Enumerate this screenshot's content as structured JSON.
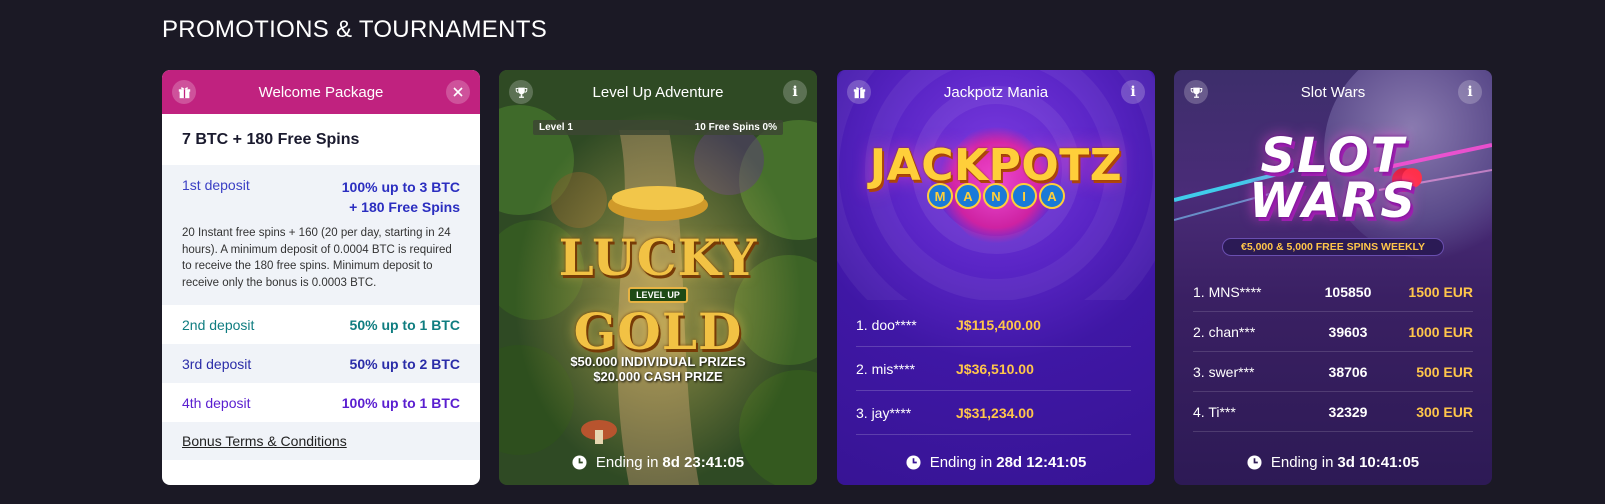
{
  "page": {
    "title": "PROMOTIONS & TOURNAMENTS"
  },
  "welcome": {
    "header": "Welcome Package",
    "headline": "7 BTC + 180 Free Spins",
    "first_deposit": {
      "label": "1st deposit",
      "value_line1": "100% up to 3 BTC",
      "value_line2": "+ 180 Free Spins",
      "description": "20 Instant free spins + 160 (20 per day, starting in 24 hours). A minimum deposit of 0.0004 BTC is required to receive the 180 free spins. Minimum deposit to receive only the bonus is 0.0003 BTC."
    },
    "deposits": [
      {
        "label": "2nd deposit",
        "value": "50% up to 1 BTC"
      },
      {
        "label": "3rd deposit",
        "value": "50% up to 2 BTC"
      },
      {
        "label": "4th deposit",
        "value": "100% up to 1 BTC"
      }
    ],
    "terms_link": "Bonus Terms & Conditions"
  },
  "levelup": {
    "header": "Level Up Adventure",
    "progress": {
      "level": "Level 1",
      "reward": "10 Free Spins 0%",
      "fraction": 0.0
    },
    "game_title_line1": "LUCKY",
    "game_badge": "LEVEL UP",
    "game_title_line2": "GOLD",
    "prize_line1": "$50.000 INDIVIDUAL PRIZES",
    "prize_line2": "$20.000 CASH PRIZE",
    "ending_label": "Ending in",
    "ending_time": "8d 23:41:05"
  },
  "jackpotz": {
    "header": "Jackpotz Mania",
    "logo_word": "JACKPOTZ",
    "logo_letters": [
      "M",
      "A",
      "N",
      "I",
      "A"
    ],
    "leaders": [
      {
        "name": "1. doo****",
        "amount": "J$115,400.00"
      },
      {
        "name": "2. mis****",
        "amount": "J$36,510.00"
      },
      {
        "name": "3. jay****",
        "amount": "J$31,234.00"
      }
    ],
    "ending_label": "Ending in",
    "ending_time": "28d 12:41:05"
  },
  "slotwars": {
    "header": "Slot Wars",
    "logo_line1": "SLOT",
    "logo_line2": "WARS",
    "banner": "€5,000 & 5,000 FREE SPINS WEEKLY",
    "leaders": [
      {
        "name": "1. MNS****",
        "score": "105850",
        "prize": "1500 EUR"
      },
      {
        "name": "2. chan***",
        "score": "39603",
        "prize": "1000 EUR"
      },
      {
        "name": "3. swer***",
        "score": "38706",
        "prize": "500 EUR"
      },
      {
        "name": "4. Ti***",
        "score": "32329",
        "prize": "300 EUR"
      }
    ],
    "ending_label": "Ending in",
    "ending_time": "3d 10:41:05"
  },
  "icons": {
    "gift": "gift-icon",
    "trophy": "trophy-icon",
    "info": "info-icon",
    "close": "close-icon",
    "clock": "clock-icon"
  },
  "colors": {
    "background": "#1b1925",
    "welcome_header": "#c0227f",
    "jackpotz_bg": "#3f17a5",
    "slotwars_bg": "#3a2063",
    "gold_text": "#ffc64a"
  }
}
